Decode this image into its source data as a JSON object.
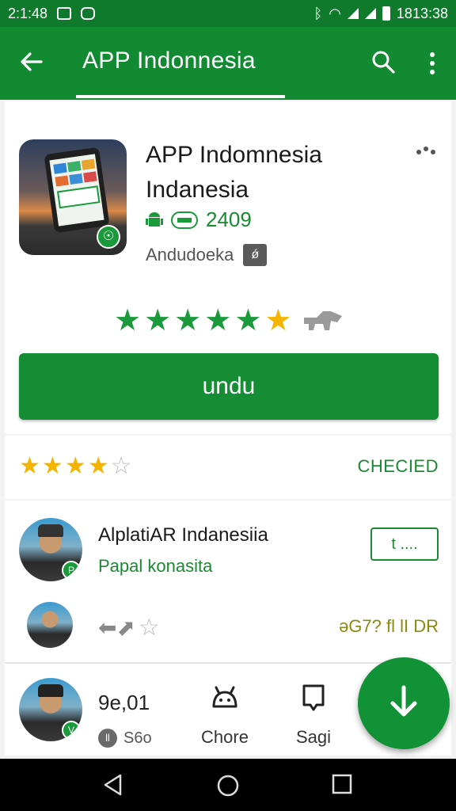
{
  "status_bar": {
    "time_left": "2:1:48",
    "time_right": "1813:38"
  },
  "app_bar": {
    "title": "APP Indonnesia",
    "back_icon": "arrow-left-icon",
    "search_icon": "search-icon",
    "more_icon": "more-vert-icon"
  },
  "app_card": {
    "name_line1": "APP Indomnesia",
    "name_line2": "Indanesia",
    "count": "2409",
    "developer": "Andudoeka",
    "developer_badge": "ǿ",
    "more_icon": "more-dots-icon",
    "stars_green": 6,
    "install_label": "undu"
  },
  "rating_row": {
    "stars_filled": 4,
    "status": "CHECIED"
  },
  "reviews": {
    "row1": {
      "name": "AlplatiAR Indanesiia",
      "subtitle": "Papal konasita",
      "button": "t ....",
      "avatar_badge": "P"
    },
    "row2": {
      "arrows": "⬅⬈",
      "right_text": "əG7? fl lI DR"
    }
  },
  "bottom_bar": {
    "item1_name": "9e,01",
    "item1_chip": "S6o",
    "item1_chip_badge": "ll",
    "item1_avatar_badge": "V",
    "item2_label": "Chore",
    "item3_label": "Sagi"
  },
  "colors": {
    "primary": "#118a32",
    "status_bar": "#0f7a2c",
    "accent_star": "#f5b400"
  }
}
